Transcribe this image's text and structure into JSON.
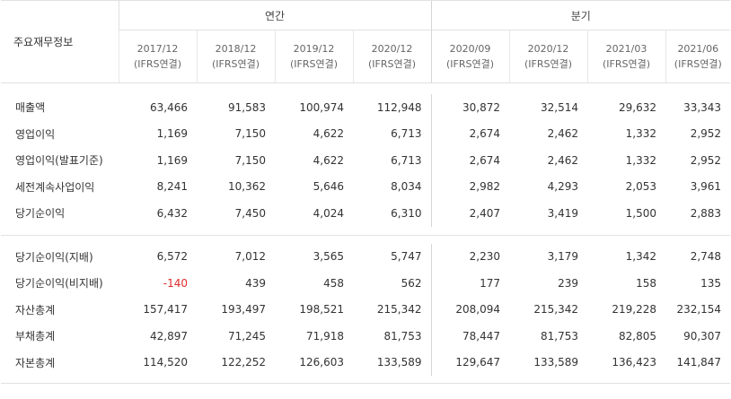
{
  "header": {
    "corner_label": "주요재무정보",
    "group_annual": "연간",
    "group_quarter": "분기",
    "periods": [
      {
        "date": "2017/12",
        "basis": "(IFRS연결)"
      },
      {
        "date": "2018/12",
        "basis": "(IFRS연결)"
      },
      {
        "date": "2019/12",
        "basis": "(IFRS연결)"
      },
      {
        "date": "2020/12",
        "basis": "(IFRS연결)"
      },
      {
        "date": "2020/09",
        "basis": "(IFRS연결)"
      },
      {
        "date": "2020/12",
        "basis": "(IFRS연결)"
      },
      {
        "date": "2021/03",
        "basis": "(IFRS연결)"
      },
      {
        "date": "2021/06",
        "basis": "(IFRS연결)"
      }
    ]
  },
  "group1": [
    {
      "label": "매출액",
      "values": [
        "63,466",
        "91,583",
        "100,974",
        "112,948",
        "30,872",
        "32,514",
        "29,632",
        "33,343"
      ]
    },
    {
      "label": "영업이익",
      "values": [
        "1,169",
        "7,150",
        "4,622",
        "6,713",
        "2,674",
        "2,462",
        "1,332",
        "2,952"
      ]
    },
    {
      "label": "영업이익(발표기준)",
      "values": [
        "1,169",
        "7,150",
        "4,622",
        "6,713",
        "2,674",
        "2,462",
        "1,332",
        "2,952"
      ]
    },
    {
      "label": "세전계속사업이익",
      "values": [
        "8,241",
        "10,362",
        "5,646",
        "8,034",
        "2,982",
        "4,293",
        "2,053",
        "3,961"
      ]
    },
    {
      "label": "당기순이익",
      "values": [
        "6,432",
        "7,450",
        "4,024",
        "6,310",
        "2,407",
        "3,419",
        "1,500",
        "2,883"
      ]
    }
  ],
  "group2": [
    {
      "label": "당기순이익(지배)",
      "values": [
        "6,572",
        "7,012",
        "3,565",
        "5,747",
        "2,230",
        "3,179",
        "1,342",
        "2,748"
      ]
    },
    {
      "label": "당기순이익(비지배)",
      "values": [
        "-140",
        "439",
        "458",
        "562",
        "177",
        "239",
        "158",
        "135"
      ]
    },
    {
      "label": "자산총계",
      "values": [
        "157,417",
        "193,497",
        "198,521",
        "215,342",
        "208,094",
        "215,342",
        "219,228",
        "232,154"
      ]
    },
    {
      "label": "부채총계",
      "values": [
        "42,897",
        "71,245",
        "71,918",
        "81,753",
        "78,447",
        "81,753",
        "82,805",
        "90,307"
      ]
    },
    {
      "label": "자본총계",
      "values": [
        "114,520",
        "122,252",
        "126,603",
        "133,589",
        "129,647",
        "133,589",
        "136,423",
        "141,847"
      ]
    }
  ],
  "colors": {
    "negative": "#e02b2b",
    "border": "#e1e1e1",
    "text": "#333333"
  }
}
